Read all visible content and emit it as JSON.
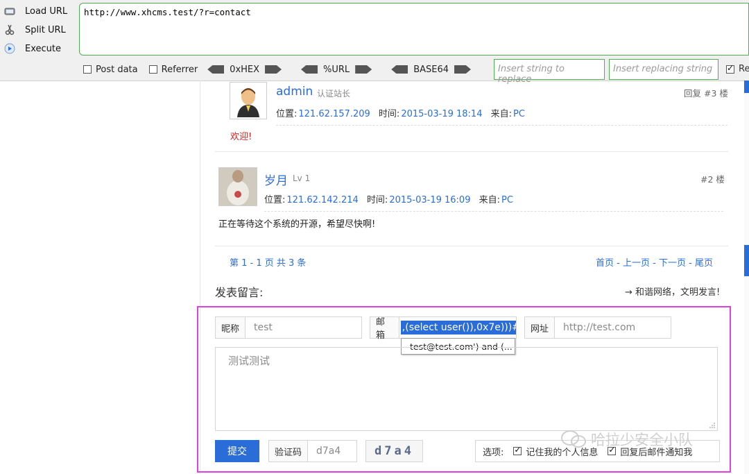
{
  "hackbar": {
    "buttons": [
      {
        "label": "Load URL",
        "icon": "load-url-icon"
      },
      {
        "label": "Split URL",
        "icon": "scissors-icon"
      },
      {
        "label": "Execute",
        "icon": "play-icon"
      }
    ],
    "url": "http://www.xhcms.test/?r=contact",
    "options": {
      "post_data": "Post data",
      "referrer": "Referrer",
      "hex": "0xHEX",
      "url": "%URL",
      "base64": "BASE64"
    },
    "replace_placeholder": "Insert string to replace",
    "replacing_placeholder": "Insert replacing string",
    "replace_all_label": "Re"
  },
  "comments": [
    {
      "user": "admin",
      "role": "认证站长",
      "floor": "回复 #3 楼",
      "location_label": "位置:",
      "location": "121.62.157.209",
      "time_label": "时间:",
      "time": "2015-03-19 18:14",
      "from_label": "来自:",
      "from": "PC",
      "body": "欢迎!"
    },
    {
      "user": "岁月",
      "role": "Lv 1",
      "floor": "#2 楼",
      "location_label": "位置:",
      "location": "121.62.142.214",
      "time_label": "时间:",
      "time": "2015-03-19 16:09",
      "from_label": "来自:",
      "from": "PC",
      "body": "正在等待这个系统的开源，希望尽快啊!"
    }
  ],
  "pagination": {
    "summary": "第 1 - 1 页 共 3 条",
    "first": "首页",
    "prev": "上一页",
    "next": "下一页",
    "last": "尾页",
    "sep": " - "
  },
  "form": {
    "title": "发表留言:",
    "notice": "→ 和谐网络，文明发言!",
    "nickname_label": "昵称",
    "nickname_value": "test",
    "email_label": "邮箱",
    "email_value": ",(select user()),0x7e)))#",
    "email_suggestion": "test@test.com') and (...",
    "website_label": "网址",
    "website_value": "http://test.com",
    "message_value": "测试测试",
    "submit_label": "提交",
    "captcha_label": "验证码",
    "captcha_value": "d7a4",
    "captcha_image_text": "d7a4",
    "options_label": "选项:",
    "remember_label": "记住我的个人信息",
    "notify_label": "回复后邮件通知我"
  },
  "watermark": "哈拉少安全小队",
  "colors": {
    "accent": "#2a6dd8",
    "frame": "#e040e0",
    "hackbar_border": "#4fae4f",
    "alert_text": "#e02020"
  }
}
